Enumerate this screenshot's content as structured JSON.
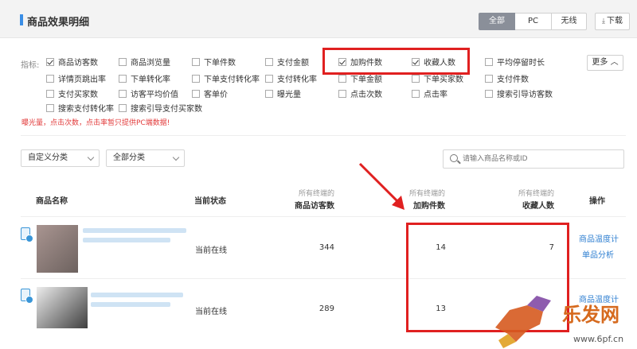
{
  "header": {
    "title": "商品效果明细",
    "segments": [
      "全部",
      "PC",
      "无线"
    ],
    "download_label": "下载"
  },
  "indicators": {
    "label": "指标:",
    "more_label": "更多 ︿",
    "items": [
      {
        "label": "商品访客数",
        "checked": true
      },
      {
        "label": "商品浏览量",
        "checked": false
      },
      {
        "label": "下单件数",
        "checked": false
      },
      {
        "label": "支付金额",
        "checked": false
      },
      {
        "label": "加购件数",
        "checked": true
      },
      {
        "label": "收藏人数",
        "checked": true
      },
      {
        "label": "平均停留时长",
        "checked": false
      },
      {
        "label": "详情页跳出率",
        "checked": false
      },
      {
        "label": "下单转化率",
        "checked": false
      },
      {
        "label": "下单支付转化率",
        "checked": false
      },
      {
        "label": "支付转化率",
        "checked": false
      },
      {
        "label": "下单金额",
        "checked": false
      },
      {
        "label": "下单买家数",
        "checked": false
      },
      {
        "label": "支付件数",
        "checked": false
      },
      {
        "label": "支付买家数",
        "checked": false
      },
      {
        "label": "访客平均价值",
        "checked": false
      },
      {
        "label": "客单价",
        "checked": false
      },
      {
        "label": "曝光量",
        "checked": false
      },
      {
        "label": "点击次数",
        "checked": false
      },
      {
        "label": "点击率",
        "checked": false
      },
      {
        "label": "搜索引导访客数",
        "checked": false
      },
      {
        "label": "搜索支付转化率",
        "checked": false
      },
      {
        "label": "搜索引导支付买家数",
        "checked": false
      }
    ],
    "warning": "曝光量，点击次数，点击率暂只提供PC端数据!"
  },
  "filters": {
    "custom_category": "自定义分类",
    "all_category": "全部分类",
    "search_placeholder": "请输入商品名称或ID"
  },
  "table": {
    "col_name": "商品名称",
    "col_status": "当前状态",
    "col_visitors_sub": "所有终端的",
    "col_visitors": "商品访客数",
    "col_cart_sub": "所有终端的",
    "col_cart": "加购件数",
    "col_fav_sub": "所有终端的",
    "col_fav": "收藏人数",
    "col_action": "操作",
    "rows": [
      {
        "status": "当前在线",
        "visitors": "344",
        "cart": "14",
        "fav": "7",
        "action1": "商品温度计",
        "action2": "单品分析"
      },
      {
        "status": "当前在线",
        "visitors": "289",
        "cart": "13",
        "fav": "",
        "action1": "商品温度计",
        "action2": ""
      }
    ]
  },
  "watermark": {
    "brand": "乐发网",
    "url": "www.6pf.cn"
  },
  "colors": {
    "accent": "#3a8ee6",
    "highlight": "#e02020",
    "link": "#2f7fd1"
  }
}
